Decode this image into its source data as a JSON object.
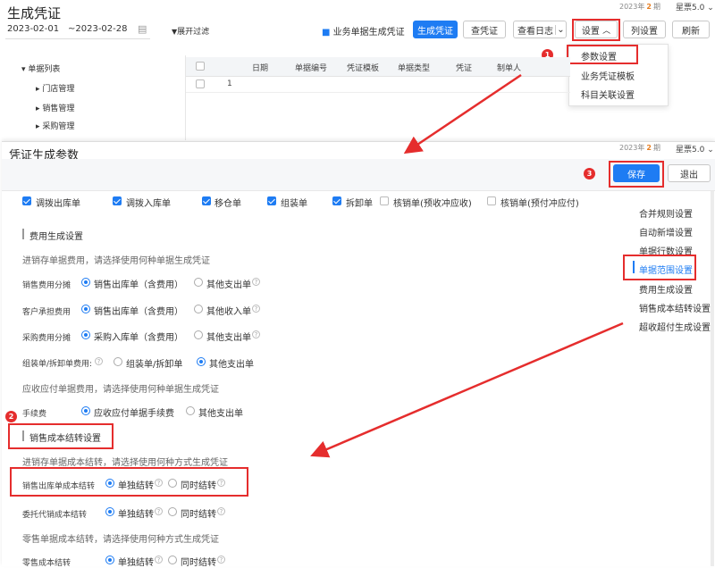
{
  "top": {
    "title": "生成凭证",
    "date_start": "2023-02-01",
    "date_end": "~2023-02-28",
    "expand_filter": "展开过滤",
    "biz_gen": "业务单据生成凭证",
    "gen": "生成凭证",
    "query": "查凭证",
    "log": "查看日志",
    "settings": "设置",
    "cols": "列设置",
    "refresh": "刷新",
    "period_year": "2023年",
    "period_num": "2",
    "period_unit": "期",
    "edition": "星票5.0"
  },
  "dropdown": {
    "items": [
      "参数设置",
      "业务凭证模板",
      "科目关联设置"
    ]
  },
  "tree": {
    "root": "单据列表",
    "items": [
      "门店管理",
      "销售管理",
      "采购管理"
    ]
  },
  "table": {
    "headers": [
      "日期",
      "单据编号",
      "凭证模板",
      "单据类型",
      "凭证",
      "制单人"
    ],
    "row_num": "1"
  },
  "panel": {
    "title": "凭证生成参数",
    "save": "保存",
    "exit": "退出",
    "period_year": "2023年",
    "period_num": "2",
    "period_unit": "期",
    "edition": "星票5.0"
  },
  "checks": [
    "调拨出库单",
    "调拨入库单",
    "移仓单",
    "组装单",
    "拆卸单",
    "核销单(预收冲应收)",
    "核销单(预付冲应付)"
  ],
  "fee": {
    "section": "费用生成设置",
    "hint1": "进销存单据费用，请选择使用何种单据生成凭证",
    "rows": [
      {
        "label": "销售费用分摊",
        "opt1": "销售出库单（含费用）",
        "opt2": "其他支出单"
      },
      {
        "label": "客户承担费用",
        "opt1": "销售出库单（含费用）",
        "opt2": "其他收入单"
      },
      {
        "label": "采购费用分摊",
        "opt1": "采购入库单（含费用）",
        "opt2": "其他支出单"
      },
      {
        "label": "组装单/拆卸单费用:",
        "opt1": "组装单/拆卸单",
        "opt2": "其他支出单"
      }
    ],
    "hint2": "应收应付单据费用，请选择使用何种单据生成凭证",
    "fee_label": "手续费",
    "fee_opt1": "应收应付单据手续费",
    "fee_opt2": "其他支出单"
  },
  "cost": {
    "section": "销售成本结转设置",
    "hint1": "进销存单据成本结转，请选择使用何种方式生成凭证",
    "rows": [
      {
        "label": "销售出库单成本结转",
        "opt1": "单独结转",
        "opt2": "同时结转"
      },
      {
        "label": "委托代销成本结转",
        "opt1": "单独结转",
        "opt2": "同时结转"
      }
    ],
    "hint2": "零售单据成本结转，请选择使用何种方式生成凭证",
    "retail_label": "零售成本结转",
    "retail_opt1": "单独结转",
    "retail_opt2": "同时结转"
  },
  "side_nav": [
    "合并规则设置",
    "自动新增设置",
    "单据行数设置",
    "单据范围设置",
    "费用生成设置",
    "销售成本结转设置",
    "超收超付生成设置"
  ],
  "badges": [
    "1",
    "2",
    "3"
  ]
}
